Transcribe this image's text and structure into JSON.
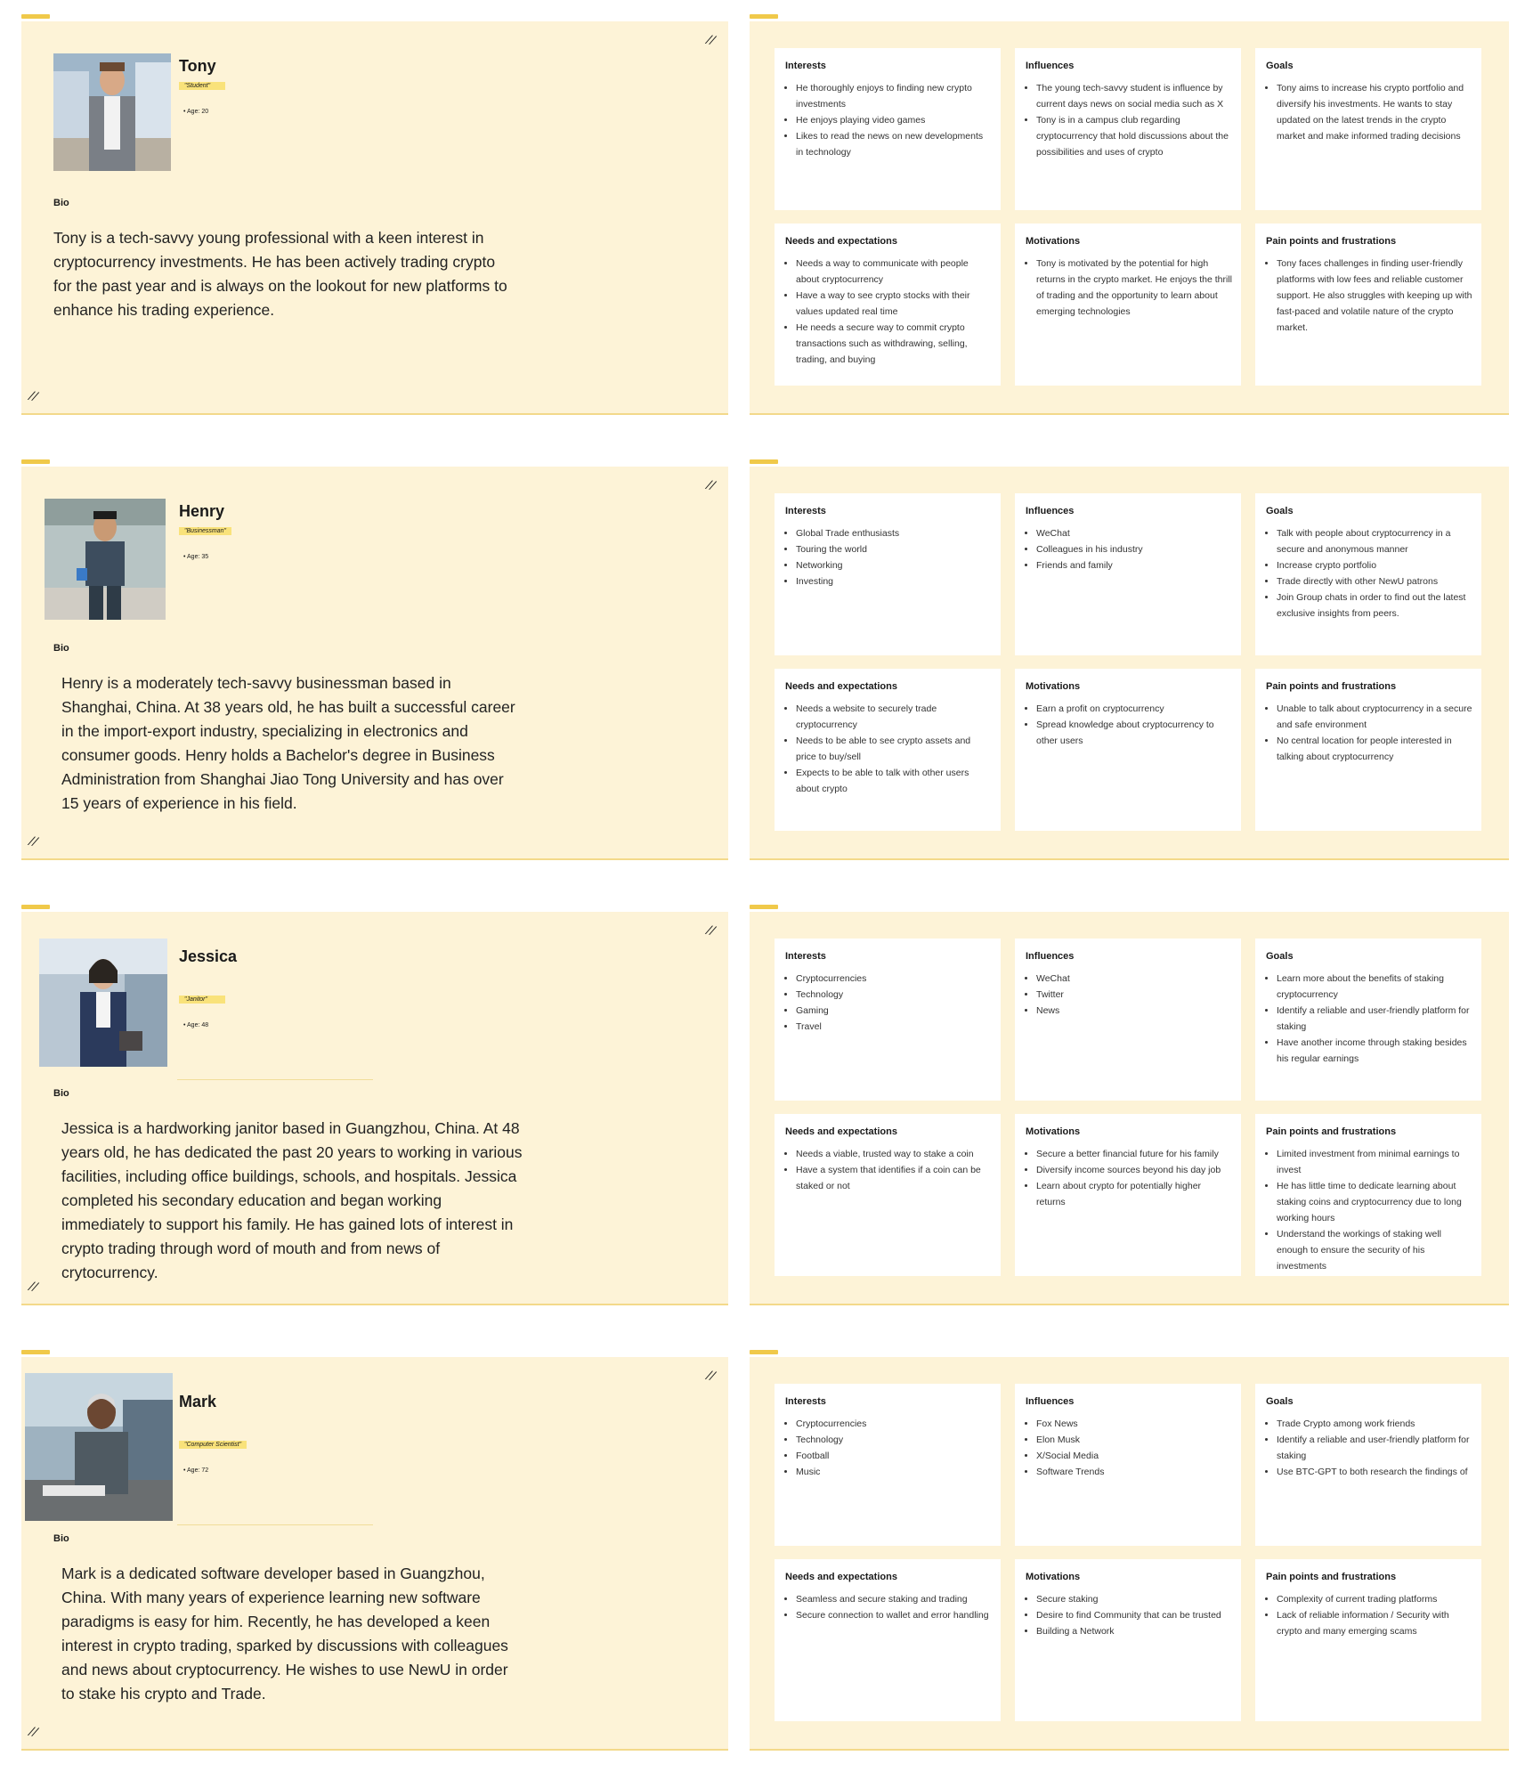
{
  "personas": [
    {
      "name": "Tony",
      "role": "\"Student\"",
      "age": "Age: 20",
      "bio_label": "Bio",
      "bio": "Tony is a tech-savvy young professional with a keen interest in cryptocurrency investments. He has been actively trading crypto for the past year and is always on the lookout for new platforms to enhance his trading experience.",
      "sections": [
        {
          "title": "Interests",
          "items": [
            "He thoroughly enjoys to finding new crypto investments",
            "He enjoys playing video games",
            "Likes to read the news on new developments in technology"
          ]
        },
        {
          "title": "Influences",
          "items": [
            "The young tech-savvy student is influence by current days news on social media such as X",
            "Tony is in a campus club regarding cryptocurrency that hold discussions about the possibilities and uses of crypto"
          ]
        },
        {
          "title": "Goals",
          "items": [
            "Tony aims to increase his crypto portfolio and diversify his investments. He wants to stay updated on the latest trends in the crypto market and make informed trading decisions"
          ]
        },
        {
          "title": "Needs and expectations",
          "items": [
            "Needs a way to communicate with people about cryptocurrency",
            "Have a way to see crypto stocks with their values updated real time",
            "He needs a secure way to commit crypto transactions such as withdrawing, selling, trading, and buying"
          ]
        },
        {
          "title": "Motivations",
          "items": [
            "Tony is motivated by the potential for high returns in the crypto market. He enjoys the thrill of trading and the opportunity to learn about emerging technologies"
          ]
        },
        {
          "title": "Pain points and frustrations",
          "items": [
            "Tony faces challenges in finding user-friendly platforms with low fees and reliable customer support. He also struggles with keeping up with fast-paced and volatile nature of the crypto market."
          ]
        }
      ]
    },
    {
      "name": "Henry",
      "role": "\"Businessman\"",
      "age": "Age: 35",
      "bio_label": "Bio",
      "bio": "Henry is a moderately tech-savvy businessman based in Shanghai, China. At 38 years old, he has built a successful career in the import-export industry, specializing in electronics and consumer goods. Henry holds a Bachelor's degree in Business Administration from Shanghai Jiao Tong University and has over 15 years of experience in his field.",
      "sections": [
        {
          "title": "Interests",
          "items": [
            "Global Trade enthusiasts",
            "Touring the world",
            "Networking",
            "Investing"
          ]
        },
        {
          "title": "Influences",
          "items": [
            "WeChat",
            "Colleagues in his industry",
            "Friends and family"
          ]
        },
        {
          "title": "Goals",
          "items": [
            "Talk with people about cryptocurrency in a secure and anonymous manner",
            "Increase crypto portfolio",
            "Trade directly with other NewU patrons",
            "Join Group chats in order to find out the latest exclusive insights from peers."
          ]
        },
        {
          "title": "Needs and expectations",
          "items": [
            "Needs a website to securely trade cryptocurrency",
            "Needs to be able to see crypto assets and price to buy/sell",
            "Expects to be able to talk with other users about crypto"
          ]
        },
        {
          "title": "Motivations",
          "items": [
            "Earn a profit on cryptocurrency",
            "Spread knowledge about cryptocurrency to other users"
          ]
        },
        {
          "title": "Pain points and frustrations",
          "items": [
            "Unable to talk about cryptocurrency in a secure and safe environment",
            "No central location for people interested in talking about cryptocurrency"
          ]
        }
      ]
    },
    {
      "name": "Jessica",
      "role": "\"Janitor\"",
      "age": "Age: 48",
      "bio_label": "Bio",
      "bio": "Jessica is a hardworking janitor based in Guangzhou, China. At 48 years old, he has dedicated the past 20 years to working in various facilities, including office buildings, schools, and hospitals. Jessica completed his secondary education and began working immediately to support his family. He has gained lots of interest in crypto trading through word of mouth and from news of crytocurrency.",
      "sections": [
        {
          "title": "Interests",
          "items": [
            "Cryptocurrencies",
            "Technology",
            "Gaming",
            "Travel"
          ]
        },
        {
          "title": "Influences",
          "items": [
            "WeChat",
            "Twitter",
            "News"
          ]
        },
        {
          "title": "Goals",
          "items": [
            "Learn more about the benefits of staking cryptocurrency",
            "Identify a reliable and user-friendly platform for staking",
            "Have another income through staking besides his regular earnings"
          ]
        },
        {
          "title": "Needs and expectations",
          "items": [
            "Needs a viable, trusted way to stake a coin",
            "Have a system that identifies if a coin can be staked or not"
          ]
        },
        {
          "title": "Motivations",
          "items": [
            "Secure a better financial future for his family",
            "Diversify income sources beyond his day job",
            "Learn about crypto for potentially higher returns"
          ]
        },
        {
          "title": "Pain points and frustrations",
          "items": [
            "Limited investment from minimal earnings to invest",
            "He has little time to dedicate learning about staking coins and cryptocurrency due to long working hours",
            "Understand the workings of staking well enough to ensure the security of his investments"
          ]
        }
      ]
    },
    {
      "name": "Mark",
      "role": "\"Computer Scientist\"",
      "age": "Age: 72",
      "bio_label": "Bio",
      "bio": "Mark is a dedicated software developer based in Guangzhou, China. With many years of experience learning new software paradigms is easy for him. Recently, he has developed a keen interest in crypto trading, sparked by discussions with colleagues and news about cryptocurrency. He wishes to use NewU in order to stake his crypto and Trade.",
      "sections": [
        {
          "title": "Interests",
          "items": [
            "Cryptocurrencies",
            "Technology",
            "Football",
            "Music"
          ]
        },
        {
          "title": "Influences",
          "items": [
            "Fox News",
            "Elon Musk",
            "X/Social Media",
            "Software Trends"
          ]
        },
        {
          "title": "Goals",
          "items": [
            "Trade Crypto among work friends",
            "Identify a reliable and user-friendly platform for staking",
            "Use BTC-GPT to both research the findings of"
          ]
        },
        {
          "title": "Needs and expectations",
          "items": [
            "Seamless and secure staking and trading",
            "Secure connection to wallet and error handling"
          ]
        },
        {
          "title": "Motivations",
          "items": [
            "Secure staking",
            "Desire to find Community that can be trusted",
            "Building a Network"
          ]
        },
        {
          "title": "Pain points and frustrations",
          "items": [
            "Complexity of current trading platforms",
            "Lack of reliable information / Security with crypto and many emerging scams"
          ]
        }
      ]
    }
  ],
  "colors": {
    "card_bg": "#fdf3d7",
    "highlight": "#f9e27a",
    "tag": "#f0c94a",
    "box_bg": "#ffffff"
  }
}
